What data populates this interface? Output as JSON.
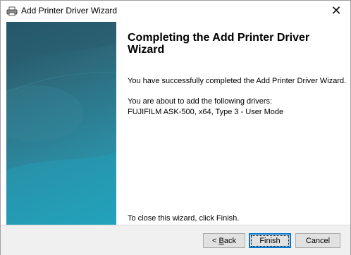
{
  "window": {
    "title": "Add Printer Driver Wizard",
    "close_glyph": "✕"
  },
  "icons": {
    "title_icon": "printer-icon",
    "close_icon": "close-icon"
  },
  "main": {
    "heading": "Completing the Add Printer Driver Wizard",
    "success_text": "You have successfully completed the Add Printer Driver Wizard.",
    "about_text": "You are about to add the following drivers:",
    "driver_text": "FUJIFILM ASK-500, x64, Type 3 - User Mode",
    "close_hint": "To close this wizard, click Finish."
  },
  "buttons": {
    "back_prefix": "< ",
    "back_access": "B",
    "back_rest": "ack",
    "finish": "Finish",
    "cancel": "Cancel"
  },
  "colors": {
    "banner_dark": "#1f4f60",
    "banner_light": "#24a1bb",
    "footer_bg": "#f0f0f0",
    "focus_border": "#0078d7"
  }
}
